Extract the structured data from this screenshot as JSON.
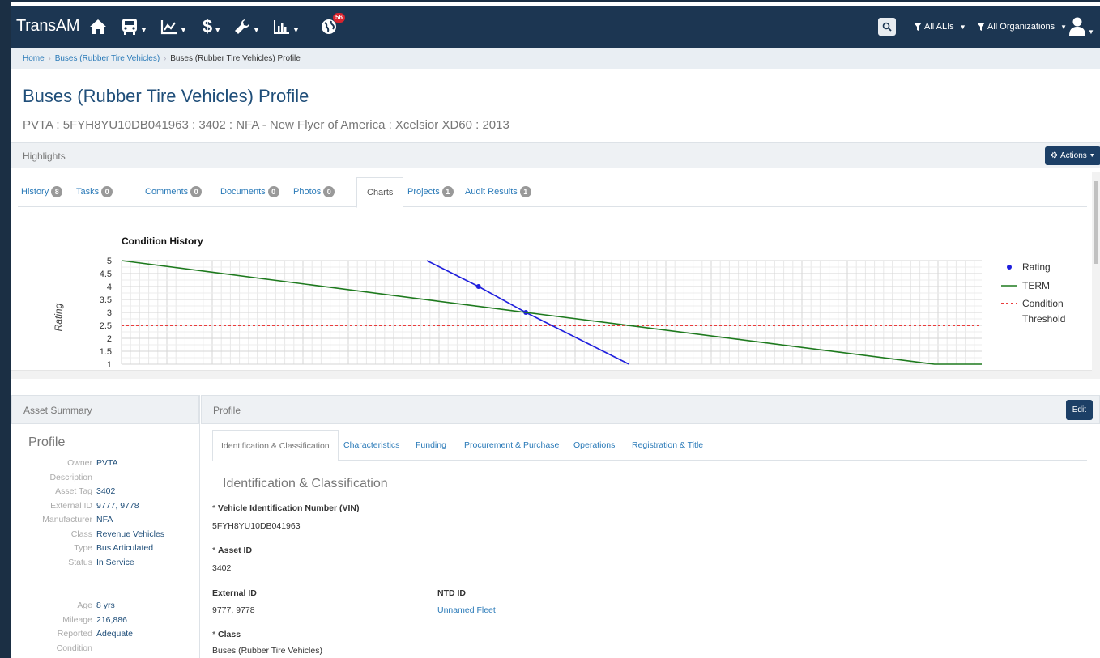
{
  "nav": {
    "brand": "TransAM",
    "alerts_badge": "56",
    "filter_alis": "All ALIs",
    "filter_orgs": "All Organizations"
  },
  "breadcrumb": {
    "home": "Home",
    "parent": "Buses (Rubber Tire Vehicles)",
    "current": "Buses (Rubber Tire Vehicles) Profile"
  },
  "page": {
    "title": "Buses (Rubber Tire Vehicles) Profile",
    "subtitle": "PVTA : 5FYH8YU10DB041963 : 3402 : NFA - New Flyer of America : Xcelsior XD60 : 2013"
  },
  "highlights": {
    "label": "Highlights",
    "actions": "Actions",
    "tabs": [
      {
        "label": "History",
        "count": "8"
      },
      {
        "label": "Tasks",
        "count": "0"
      },
      {
        "label": "Comments",
        "count": "0"
      },
      {
        "label": "Documents",
        "count": "0"
      },
      {
        "label": "Photos",
        "count": "0"
      },
      {
        "label": "Charts",
        "count": ""
      },
      {
        "label": "Projects",
        "count": "1"
      },
      {
        "label": "Audit Results",
        "count": "1"
      }
    ]
  },
  "chart_data": {
    "type": "line",
    "title": "Condition History",
    "ylabel": "Rating",
    "ylim": [
      1,
      5
    ],
    "yticks": [
      "5",
      "4.5",
      "4",
      "3.5",
      "3",
      "2.5",
      "2",
      "1.5",
      "1"
    ],
    "series": [
      {
        "name": "Rating",
        "color": "#1f1fdd",
        "points": [
          [
            0.355,
            5.0
          ],
          [
            0.415,
            4.0
          ],
          [
            0.47,
            3.0
          ],
          [
            0.59,
            1.0
          ]
        ]
      },
      {
        "name": "TERM",
        "color": "#1e7a1e",
        "points": [
          [
            0.0,
            5.0
          ],
          [
            0.47,
            3.0
          ],
          [
            0.945,
            1.0
          ],
          [
            1.0,
            1.0
          ]
        ]
      }
    ],
    "threshold": {
      "name": "Condition Threshold",
      "value": 2.5,
      "color": "#e82020"
    },
    "legend": [
      "Rating",
      "TERM",
      "Condition",
      "Threshold"
    ]
  },
  "asset_summary": {
    "header": "Asset Summary",
    "title": "Profile",
    "rows": [
      {
        "k": "Owner",
        "v": "PVTA"
      },
      {
        "k": "Description",
        "v": ""
      },
      {
        "k": "Asset Tag",
        "v": "3402"
      },
      {
        "k": "External ID",
        "v": "9777, 9778"
      },
      {
        "k": "Manufacturer",
        "v": "NFA"
      },
      {
        "k": "Class",
        "v": "Revenue Vehicles"
      },
      {
        "k": "Type",
        "v": "Bus Articulated"
      },
      {
        "k": "Status",
        "v": "In Service"
      }
    ],
    "rows2": [
      {
        "k": "Age",
        "v": "8 yrs"
      },
      {
        "k": "Mileage",
        "v": "216,886"
      },
      {
        "k": "Reported",
        "v": "Adequate"
      },
      {
        "k": "Condition",
        "v": ""
      }
    ]
  },
  "profile": {
    "header": "Profile",
    "edit": "Edit",
    "tabs": [
      "Identification & Classification",
      "Characteristics",
      "Funding",
      "Procurement & Purchase",
      "Operations",
      "Registration & Title"
    ],
    "section_title": "Identification & Classification",
    "fields": {
      "vin_label": "Vehicle Identification Number (VIN)",
      "vin_value": "5FYH8YU10DB041963",
      "asset_id_label": "Asset ID",
      "asset_id_value": "3402",
      "external_id_label": "External ID",
      "external_id_value": "9777, 9778",
      "ntd_id_label": "NTD ID",
      "ntd_id_value": "Unnamed Fleet",
      "class_label": "Class",
      "class_value": "Buses (Rubber Tire Vehicles)"
    }
  }
}
